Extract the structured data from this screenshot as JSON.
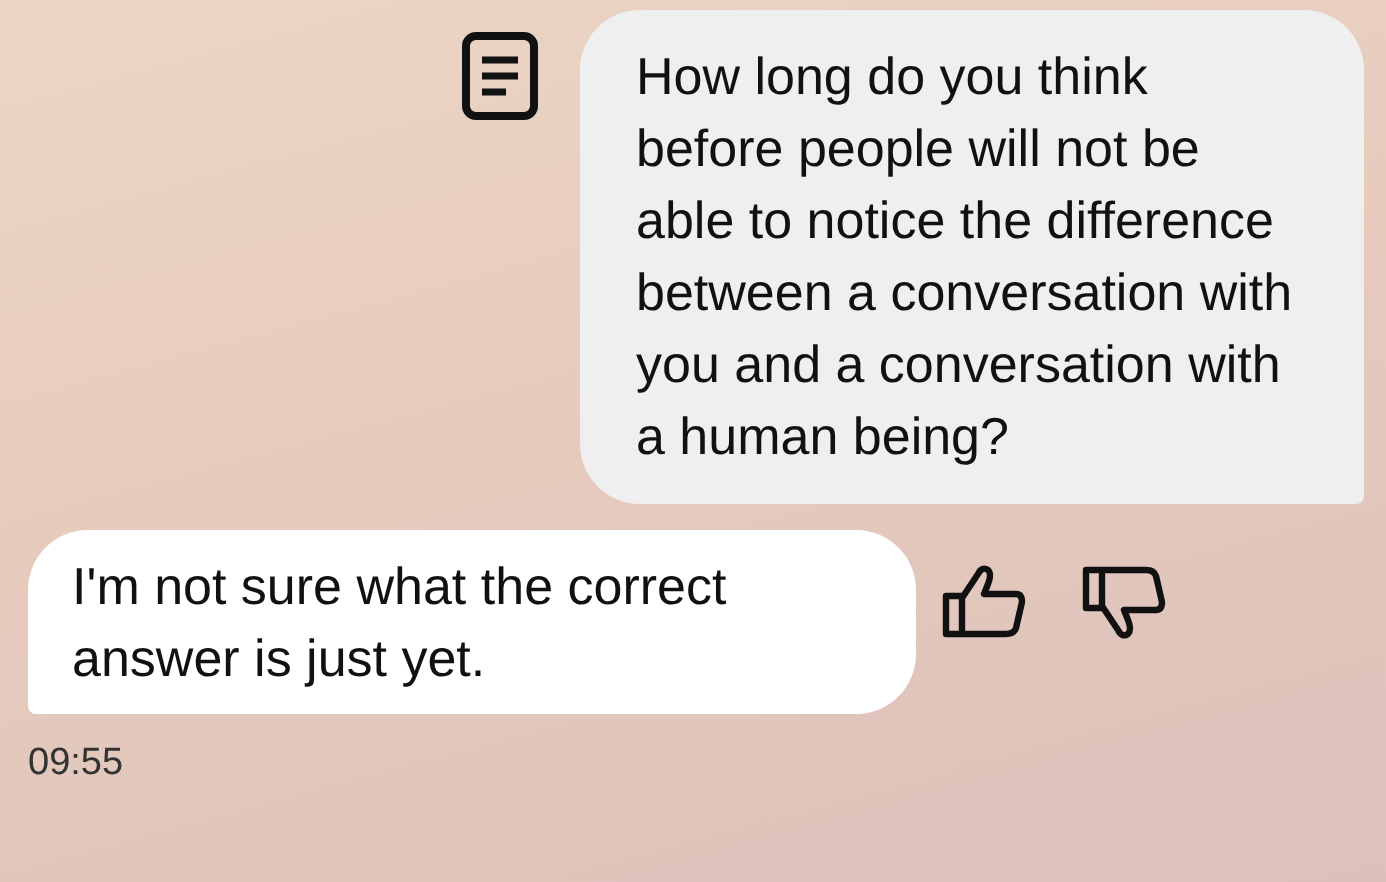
{
  "messages": [
    {
      "kind": "outgoing",
      "text": "How long do you think before people will not be able to notice the difference between a conversation with you and a conversation with a human being?"
    },
    {
      "kind": "incoming",
      "text": "I'm not sure what the correct answer is just yet."
    }
  ],
  "time": "09:55"
}
